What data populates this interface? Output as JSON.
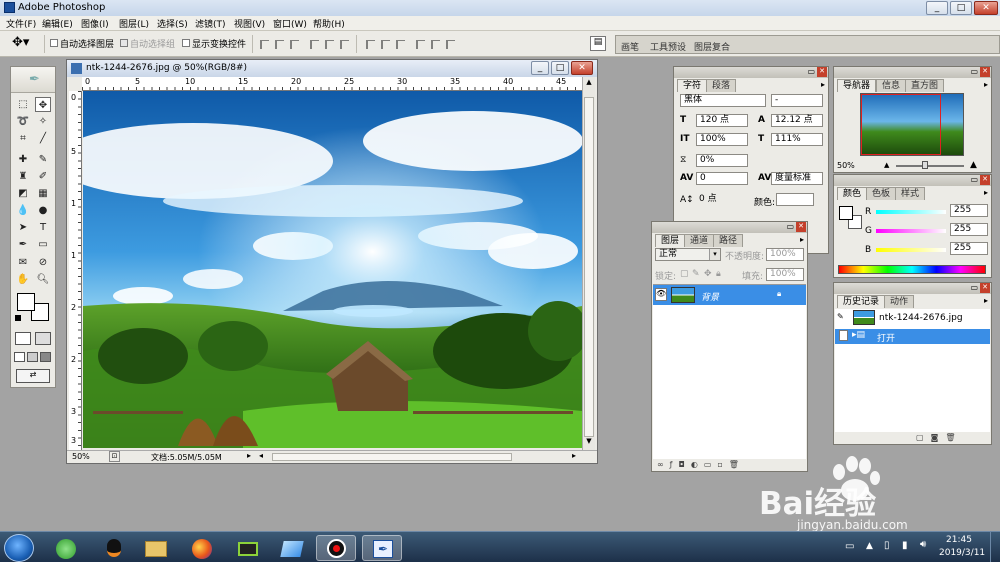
{
  "app": {
    "title": "Adobe Photoshop"
  },
  "window_buttons": [
    "_",
    "□",
    "✕"
  ],
  "menu": [
    "文件(F)",
    "编辑(E)",
    "图像(I)",
    "图层(L)",
    "选择(S)",
    "滤镜(T)",
    "视图(V)",
    "窗口(W)",
    "帮助(H)"
  ],
  "options": {
    "auto_select_layer": "自动选择图层",
    "auto_select_group": "自动选择组",
    "show_transform": "显示变换控件"
  },
  "palette_well": [
    "画笔",
    "工具预设",
    "图层复合"
  ],
  "document": {
    "title": "ntk-1244-2676.jpg @ 50%(RGB/8#)",
    "zoom": "50%",
    "doc_info": "文档:5.05M/5.05M",
    "ruler_h": [
      "0",
      "5",
      "10",
      "15",
      "20",
      "25",
      "30",
      "35",
      "40",
      "45"
    ],
    "ruler_v": [
      "0",
      "5",
      "1",
      "1",
      "2",
      "2",
      "3",
      "3"
    ]
  },
  "character_panel": {
    "tabs": [
      "字符",
      "段落"
    ],
    "font_family": "黑体",
    "font_style": "-",
    "font_size": "120 点",
    "leading": "12.12 点",
    "vertical_scale": "100%",
    "horizontal_scale": "111%",
    "tracking_pct": "0%",
    "kerning": "0",
    "kerning_method": "度量标准",
    "baseline_shift": "0 点",
    "color_label": "颜色:"
  },
  "layers_panel": {
    "tabs": [
      "图层",
      "通道",
      "路径"
    ],
    "blend_mode": "正常",
    "opacity_label": "不透明度:",
    "opacity": "100%",
    "lock_label": "锁定:",
    "fill_label": "填充:",
    "fill": "100%",
    "layers": [
      {
        "name": "背景",
        "visible": true,
        "locked": true
      }
    ]
  },
  "navigator_panel": {
    "tabs": [
      "导航器",
      "信息",
      "直方图"
    ],
    "zoom": "50%"
  },
  "color_panel": {
    "tabs": [
      "颜色",
      "色板",
      "样式"
    ],
    "channels": [
      {
        "label": "R",
        "value": "255",
        "color": "#e02020"
      },
      {
        "label": "G",
        "value": "255",
        "color": "#20c020"
      },
      {
        "label": "B",
        "value": "255",
        "color": "#2020e0"
      }
    ]
  },
  "history_panel": {
    "tabs": [
      "历史记录",
      "动作"
    ],
    "snapshot": "ntk-1244-2676.jpg",
    "steps": [
      "打开"
    ]
  },
  "watermark": {
    "brand": "Bai经验",
    "url": "jingyan.baidu.com"
  },
  "taskbar": {
    "time": "21:45",
    "date": "2019/3/11",
    "apps": [
      "start",
      "browser-360",
      "qq",
      "file-explorer",
      "firefox",
      "media-player",
      "flashfxp",
      "screen-recorder",
      "photoshop"
    ]
  },
  "colors": {
    "selection": "#3a8ee6",
    "titlebar": "#c6d6ea",
    "panel_bg": "#ecebe6",
    "taskbar": "#1d3049"
  }
}
